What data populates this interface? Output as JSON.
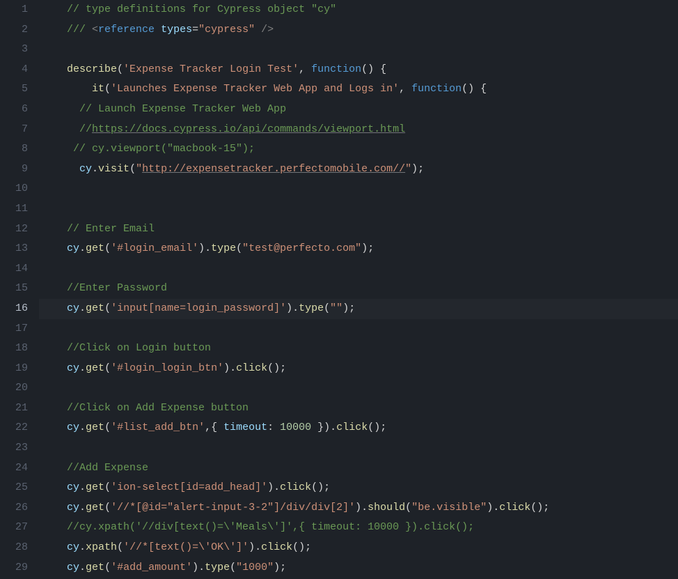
{
  "lines": [
    {
      "num": "1",
      "indent": "    ",
      "tokens": [
        {
          "cls": "tok-comment",
          "t": "// type definitions for Cypress object \"cy\""
        }
      ]
    },
    {
      "num": "2",
      "indent": "    ",
      "tokens": [
        {
          "cls": "tok-comment",
          "t": "/// "
        },
        {
          "cls": "tok-tag",
          "t": "<"
        },
        {
          "cls": "tok-keyword",
          "t": "reference"
        },
        {
          "cls": "tok-plain",
          "t": " "
        },
        {
          "cls": "tok-attrname",
          "t": "types"
        },
        {
          "cls": "tok-plain",
          "t": "="
        },
        {
          "cls": "tok-attrval",
          "t": "\"cypress\""
        },
        {
          "cls": "tok-plain",
          "t": " "
        },
        {
          "cls": "tok-tag",
          "t": "/>"
        }
      ]
    },
    {
      "num": "3",
      "indent": "",
      "tokens": []
    },
    {
      "num": "4",
      "indent": "    ",
      "tokens": [
        {
          "cls": "tok-func",
          "t": "describe"
        },
        {
          "cls": "tok-punct",
          "t": "("
        },
        {
          "cls": "tok-string",
          "t": "'Expense Tracker Login Test'"
        },
        {
          "cls": "tok-punct",
          "t": ", "
        },
        {
          "cls": "tok-keyword",
          "t": "function"
        },
        {
          "cls": "tok-punct",
          "t": "() {"
        }
      ]
    },
    {
      "num": "5",
      "indent": "        ",
      "tokens": [
        {
          "cls": "tok-func",
          "t": "it"
        },
        {
          "cls": "tok-punct",
          "t": "("
        },
        {
          "cls": "tok-string",
          "t": "'Launches Expense Tracker Web App and Logs in'"
        },
        {
          "cls": "tok-punct",
          "t": ", "
        },
        {
          "cls": "tok-keyword",
          "t": "function"
        },
        {
          "cls": "tok-punct",
          "t": "() {"
        }
      ]
    },
    {
      "num": "6",
      "indent": "      ",
      "tokens": [
        {
          "cls": "tok-comment",
          "t": "// Launch Expense Tracker Web App"
        }
      ]
    },
    {
      "num": "7",
      "indent": "      ",
      "tokens": [
        {
          "cls": "tok-comment",
          "t": "//"
        },
        {
          "cls": "tok-comment underline",
          "t": "https://docs.cypress.io/api/commands/viewport.html"
        }
      ]
    },
    {
      "num": "8",
      "indent": "     ",
      "tokens": [
        {
          "cls": "tok-comment",
          "t": "// cy.viewport(\"macbook-15\");"
        }
      ]
    },
    {
      "num": "9",
      "indent": "      ",
      "tokens": [
        {
          "cls": "tok-var",
          "t": "cy"
        },
        {
          "cls": "tok-punct",
          "t": "."
        },
        {
          "cls": "tok-func",
          "t": "visit"
        },
        {
          "cls": "tok-punct",
          "t": "("
        },
        {
          "cls": "tok-string",
          "t": "\""
        },
        {
          "cls": "tok-string underline",
          "t": "http://expensetracker.perfectomobile.com//"
        },
        {
          "cls": "tok-string",
          "t": "\""
        },
        {
          "cls": "tok-punct",
          "t": ");"
        }
      ]
    },
    {
      "num": "10",
      "indent": "",
      "tokens": []
    },
    {
      "num": "11",
      "indent": "",
      "tokens": []
    },
    {
      "num": "12",
      "indent": "    ",
      "tokens": [
        {
          "cls": "tok-comment",
          "t": "// Enter Email"
        }
      ]
    },
    {
      "num": "13",
      "indent": "    ",
      "tokens": [
        {
          "cls": "tok-var",
          "t": "cy"
        },
        {
          "cls": "tok-punct",
          "t": "."
        },
        {
          "cls": "tok-func",
          "t": "get"
        },
        {
          "cls": "tok-punct",
          "t": "("
        },
        {
          "cls": "tok-string",
          "t": "'#login_email'"
        },
        {
          "cls": "tok-punct",
          "t": ")."
        },
        {
          "cls": "tok-func",
          "t": "type"
        },
        {
          "cls": "tok-punct",
          "t": "("
        },
        {
          "cls": "tok-string",
          "t": "\"test@perfecto.com\""
        },
        {
          "cls": "tok-punct",
          "t": ");"
        }
      ]
    },
    {
      "num": "14",
      "indent": "",
      "tokens": []
    },
    {
      "num": "15",
      "indent": "    ",
      "tokens": [
        {
          "cls": "tok-comment",
          "t": "//Enter Password"
        }
      ]
    },
    {
      "num": "16",
      "current": true,
      "indent": "    ",
      "tokens": [
        {
          "cls": "tok-var",
          "t": "cy"
        },
        {
          "cls": "tok-punct",
          "t": "."
        },
        {
          "cls": "tok-func",
          "t": "get"
        },
        {
          "cls": "tok-punct",
          "t": "("
        },
        {
          "cls": "tok-string",
          "t": "'input[name=login_password]'"
        },
        {
          "cls": "tok-punct",
          "t": ")."
        },
        {
          "cls": "tok-func",
          "t": "type"
        },
        {
          "cls": "tok-punct",
          "t": "("
        },
        {
          "cls": "tok-string",
          "t": "\"\""
        },
        {
          "cls": "tok-punct",
          "t": ");"
        }
      ]
    },
    {
      "num": "17",
      "indent": "",
      "tokens": []
    },
    {
      "num": "18",
      "indent": "    ",
      "tokens": [
        {
          "cls": "tok-comment",
          "t": "//Click on Login button"
        }
      ]
    },
    {
      "num": "19",
      "indent": "    ",
      "tokens": [
        {
          "cls": "tok-var",
          "t": "cy"
        },
        {
          "cls": "tok-punct",
          "t": "."
        },
        {
          "cls": "tok-func",
          "t": "get"
        },
        {
          "cls": "tok-punct",
          "t": "("
        },
        {
          "cls": "tok-string",
          "t": "'#login_login_btn'"
        },
        {
          "cls": "tok-punct",
          "t": ")."
        },
        {
          "cls": "tok-func",
          "t": "click"
        },
        {
          "cls": "tok-punct",
          "t": "();"
        }
      ]
    },
    {
      "num": "20",
      "indent": "",
      "tokens": []
    },
    {
      "num": "21",
      "indent": "    ",
      "tokens": [
        {
          "cls": "tok-comment",
          "t": "//Click on Add Expense button"
        }
      ]
    },
    {
      "num": "22",
      "indent": "    ",
      "tokens": [
        {
          "cls": "tok-var",
          "t": "cy"
        },
        {
          "cls": "tok-punct",
          "t": "."
        },
        {
          "cls": "tok-func",
          "t": "get"
        },
        {
          "cls": "tok-punct",
          "t": "("
        },
        {
          "cls": "tok-string",
          "t": "'#list_add_btn'"
        },
        {
          "cls": "tok-punct",
          "t": ",{ "
        },
        {
          "cls": "tok-var",
          "t": "timeout"
        },
        {
          "cls": "tok-punct",
          "t": ": "
        },
        {
          "cls": "tok-number",
          "t": "10000"
        },
        {
          "cls": "tok-punct",
          "t": " })."
        },
        {
          "cls": "tok-func",
          "t": "click"
        },
        {
          "cls": "tok-punct",
          "t": "();"
        }
      ]
    },
    {
      "num": "23",
      "indent": "",
      "tokens": []
    },
    {
      "num": "24",
      "indent": "    ",
      "tokens": [
        {
          "cls": "tok-comment",
          "t": "//Add Expense"
        }
      ]
    },
    {
      "num": "25",
      "indent": "    ",
      "tokens": [
        {
          "cls": "tok-var",
          "t": "cy"
        },
        {
          "cls": "tok-punct",
          "t": "."
        },
        {
          "cls": "tok-func",
          "t": "get"
        },
        {
          "cls": "tok-punct",
          "t": "("
        },
        {
          "cls": "tok-string",
          "t": "'ion-select[id=add_head]'"
        },
        {
          "cls": "tok-punct",
          "t": ")."
        },
        {
          "cls": "tok-func",
          "t": "click"
        },
        {
          "cls": "tok-punct",
          "t": "();"
        }
      ]
    },
    {
      "num": "26",
      "indent": "    ",
      "tokens": [
        {
          "cls": "tok-var",
          "t": "cy"
        },
        {
          "cls": "tok-punct",
          "t": "."
        },
        {
          "cls": "tok-func",
          "t": "get"
        },
        {
          "cls": "tok-punct",
          "t": "("
        },
        {
          "cls": "tok-string",
          "t": "'//*[@id=\"alert-input-3-2\"]/div/div[2]'"
        },
        {
          "cls": "tok-punct",
          "t": ")."
        },
        {
          "cls": "tok-func",
          "t": "should"
        },
        {
          "cls": "tok-punct",
          "t": "("
        },
        {
          "cls": "tok-string",
          "t": "\"be.visible\""
        },
        {
          "cls": "tok-punct",
          "t": ")."
        },
        {
          "cls": "tok-func",
          "t": "click"
        },
        {
          "cls": "tok-punct",
          "t": "();"
        }
      ]
    },
    {
      "num": "27",
      "indent": "    ",
      "tokens": [
        {
          "cls": "tok-comment",
          "t": "//cy.xpath('//div[text()=\\'Meals\\']',{ timeout: 10000 }).click();"
        }
      ]
    },
    {
      "num": "28",
      "indent": "    ",
      "tokens": [
        {
          "cls": "tok-var",
          "t": "cy"
        },
        {
          "cls": "tok-punct",
          "t": "."
        },
        {
          "cls": "tok-func",
          "t": "xpath"
        },
        {
          "cls": "tok-punct",
          "t": "("
        },
        {
          "cls": "tok-string",
          "t": "'//*[text()=\\'OK\\']'"
        },
        {
          "cls": "tok-punct",
          "t": ")."
        },
        {
          "cls": "tok-func",
          "t": "click"
        },
        {
          "cls": "tok-punct",
          "t": "();"
        }
      ]
    },
    {
      "num": "29",
      "indent": "    ",
      "tokens": [
        {
          "cls": "tok-var",
          "t": "cy"
        },
        {
          "cls": "tok-punct",
          "t": "."
        },
        {
          "cls": "tok-func",
          "t": "get"
        },
        {
          "cls": "tok-punct",
          "t": "("
        },
        {
          "cls": "tok-string",
          "t": "'#add_amount'"
        },
        {
          "cls": "tok-punct",
          "t": ")."
        },
        {
          "cls": "tok-func",
          "t": "type"
        },
        {
          "cls": "tok-punct",
          "t": "("
        },
        {
          "cls": "tok-string",
          "t": "\"1000\""
        },
        {
          "cls": "tok-punct",
          "t": ");"
        }
      ]
    }
  ]
}
